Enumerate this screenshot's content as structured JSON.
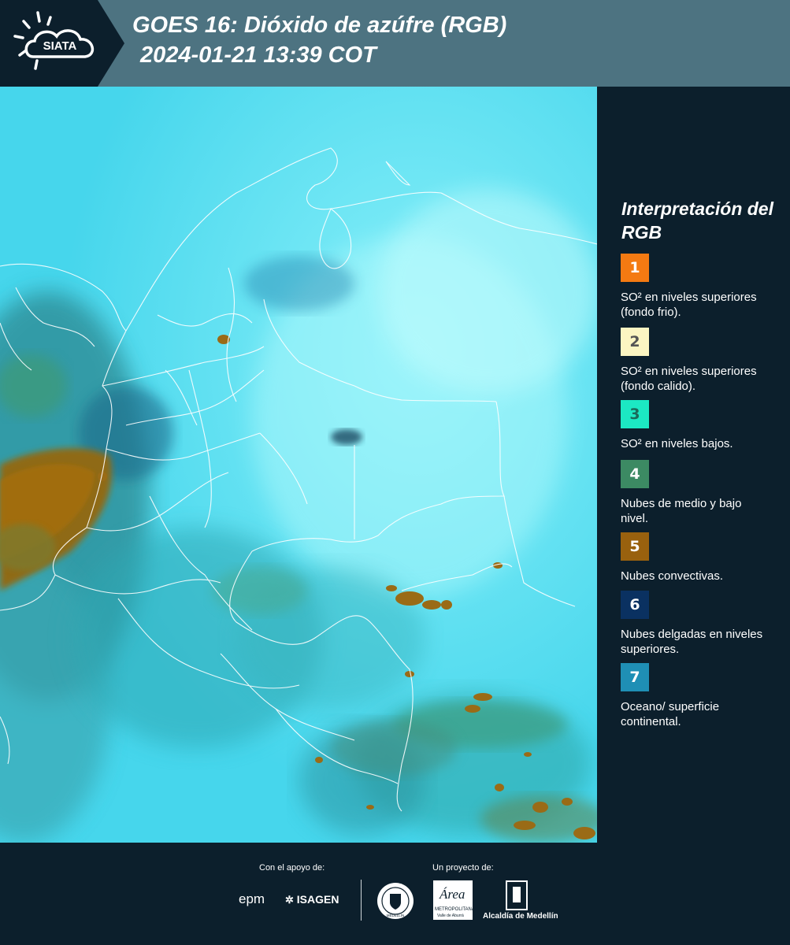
{
  "header": {
    "logo_text": "SIATA",
    "title_line1": "GOES 16: Dióxido de azúfre (RGB)",
    "title_line2": "2024-01-21 13:39 COT"
  },
  "legend": {
    "title": "Interpretación del RGB",
    "items": [
      {
        "number": "1",
        "label": "SO² en niveles superiores (fondo frio).",
        "color": "#f47a12",
        "text_color": "#ffffff"
      },
      {
        "number": "2",
        "label": "SO² en niveles superiores (fondo calido).",
        "color": "#fbf5c2",
        "text_color": "#555555"
      },
      {
        "number": "3",
        "label": "SO² en niveles bajos.",
        "color": "#1ce8c3",
        "text_color": "#1a6a5a"
      },
      {
        "number": "4",
        "label": "Nubes de medio y bajo nivel.",
        "color": "#3c8a63",
        "text_color": "#ffffff"
      },
      {
        "number": "5",
        "label": "Nubes convectivas.",
        "color": "#99610e",
        "text_color": "#ffffff"
      },
      {
        "number": "6",
        "label": "Nubes delgadas en niveles superiores.",
        "color": "#0a3161",
        "text_color": "#ffffff"
      },
      {
        "number": "7",
        "label": "Oceano/ superficie continental.",
        "color": "#1f8fb5",
        "text_color": "#ffffff"
      }
    ]
  },
  "footer": {
    "support_label": "Con el apoyo de:",
    "project_label": "Un proyecto de:",
    "sponsor_1": "epm",
    "sponsor_2": "ISAGEN",
    "partner_seal_text": "MEDELLÍN",
    "partner_area": "Área",
    "partner_area_sub": "METROPOLITANA",
    "partner_area_sub2": "Valle de Aburrá",
    "partner_alcaldia": "Alcaldía de Medellín"
  }
}
